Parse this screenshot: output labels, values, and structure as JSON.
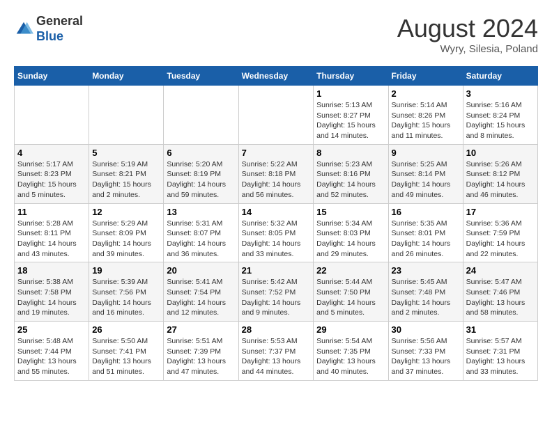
{
  "logo": {
    "general": "General",
    "blue": "Blue"
  },
  "header": {
    "month_year": "August 2024",
    "location": "Wyry, Silesia, Poland"
  },
  "days_of_week": [
    "Sunday",
    "Monday",
    "Tuesday",
    "Wednesday",
    "Thursday",
    "Friday",
    "Saturday"
  ],
  "weeks": [
    [
      {
        "day": "",
        "info": ""
      },
      {
        "day": "",
        "info": ""
      },
      {
        "day": "",
        "info": ""
      },
      {
        "day": "",
        "info": ""
      },
      {
        "day": "1",
        "info": "Sunrise: 5:13 AM\nSunset: 8:27 PM\nDaylight: 15 hours and 14 minutes."
      },
      {
        "day": "2",
        "info": "Sunrise: 5:14 AM\nSunset: 8:26 PM\nDaylight: 15 hours and 11 minutes."
      },
      {
        "day": "3",
        "info": "Sunrise: 5:16 AM\nSunset: 8:24 PM\nDaylight: 15 hours and 8 minutes."
      }
    ],
    [
      {
        "day": "4",
        "info": "Sunrise: 5:17 AM\nSunset: 8:23 PM\nDaylight: 15 hours and 5 minutes."
      },
      {
        "day": "5",
        "info": "Sunrise: 5:19 AM\nSunset: 8:21 PM\nDaylight: 15 hours and 2 minutes."
      },
      {
        "day": "6",
        "info": "Sunrise: 5:20 AM\nSunset: 8:19 PM\nDaylight: 14 hours and 59 minutes."
      },
      {
        "day": "7",
        "info": "Sunrise: 5:22 AM\nSunset: 8:18 PM\nDaylight: 14 hours and 56 minutes."
      },
      {
        "day": "8",
        "info": "Sunrise: 5:23 AM\nSunset: 8:16 PM\nDaylight: 14 hours and 52 minutes."
      },
      {
        "day": "9",
        "info": "Sunrise: 5:25 AM\nSunset: 8:14 PM\nDaylight: 14 hours and 49 minutes."
      },
      {
        "day": "10",
        "info": "Sunrise: 5:26 AM\nSunset: 8:12 PM\nDaylight: 14 hours and 46 minutes."
      }
    ],
    [
      {
        "day": "11",
        "info": "Sunrise: 5:28 AM\nSunset: 8:11 PM\nDaylight: 14 hours and 43 minutes."
      },
      {
        "day": "12",
        "info": "Sunrise: 5:29 AM\nSunset: 8:09 PM\nDaylight: 14 hours and 39 minutes."
      },
      {
        "day": "13",
        "info": "Sunrise: 5:31 AM\nSunset: 8:07 PM\nDaylight: 14 hours and 36 minutes."
      },
      {
        "day": "14",
        "info": "Sunrise: 5:32 AM\nSunset: 8:05 PM\nDaylight: 14 hours and 33 minutes."
      },
      {
        "day": "15",
        "info": "Sunrise: 5:34 AM\nSunset: 8:03 PM\nDaylight: 14 hours and 29 minutes."
      },
      {
        "day": "16",
        "info": "Sunrise: 5:35 AM\nSunset: 8:01 PM\nDaylight: 14 hours and 26 minutes."
      },
      {
        "day": "17",
        "info": "Sunrise: 5:36 AM\nSunset: 7:59 PM\nDaylight: 14 hours and 22 minutes."
      }
    ],
    [
      {
        "day": "18",
        "info": "Sunrise: 5:38 AM\nSunset: 7:58 PM\nDaylight: 14 hours and 19 minutes."
      },
      {
        "day": "19",
        "info": "Sunrise: 5:39 AM\nSunset: 7:56 PM\nDaylight: 14 hours and 16 minutes."
      },
      {
        "day": "20",
        "info": "Sunrise: 5:41 AM\nSunset: 7:54 PM\nDaylight: 14 hours and 12 minutes."
      },
      {
        "day": "21",
        "info": "Sunrise: 5:42 AM\nSunset: 7:52 PM\nDaylight: 14 hours and 9 minutes."
      },
      {
        "day": "22",
        "info": "Sunrise: 5:44 AM\nSunset: 7:50 PM\nDaylight: 14 hours and 5 minutes."
      },
      {
        "day": "23",
        "info": "Sunrise: 5:45 AM\nSunset: 7:48 PM\nDaylight: 14 hours and 2 minutes."
      },
      {
        "day": "24",
        "info": "Sunrise: 5:47 AM\nSunset: 7:46 PM\nDaylight: 13 hours and 58 minutes."
      }
    ],
    [
      {
        "day": "25",
        "info": "Sunrise: 5:48 AM\nSunset: 7:44 PM\nDaylight: 13 hours and 55 minutes."
      },
      {
        "day": "26",
        "info": "Sunrise: 5:50 AM\nSunset: 7:41 PM\nDaylight: 13 hours and 51 minutes."
      },
      {
        "day": "27",
        "info": "Sunrise: 5:51 AM\nSunset: 7:39 PM\nDaylight: 13 hours and 47 minutes."
      },
      {
        "day": "28",
        "info": "Sunrise: 5:53 AM\nSunset: 7:37 PM\nDaylight: 13 hours and 44 minutes."
      },
      {
        "day": "29",
        "info": "Sunrise: 5:54 AM\nSunset: 7:35 PM\nDaylight: 13 hours and 40 minutes."
      },
      {
        "day": "30",
        "info": "Sunrise: 5:56 AM\nSunset: 7:33 PM\nDaylight: 13 hours and 37 minutes."
      },
      {
        "day": "31",
        "info": "Sunrise: 5:57 AM\nSunset: 7:31 PM\nDaylight: 13 hours and 33 minutes."
      }
    ]
  ]
}
